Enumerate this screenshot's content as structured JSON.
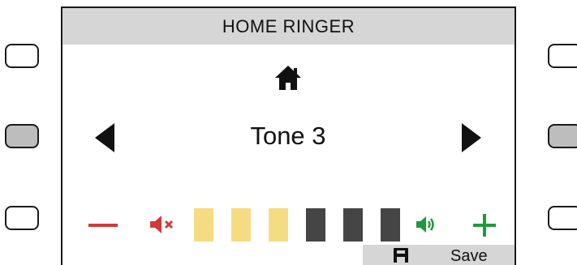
{
  "screen": {
    "title": "HOME RINGER",
    "header_icon": "home-icon",
    "tone": "Tone 3",
    "prev_icon": "left-triangle-icon",
    "next_icon": "right-triangle-icon"
  },
  "volume": {
    "level": 3,
    "max": 6,
    "decrease_icon": "minus-icon",
    "mute_icon": "speaker-mute-icon",
    "loud_icon": "speaker-loud-icon",
    "increase_icon": "plus-icon",
    "colors": {
      "on": "#f5dc82",
      "off": "#454545",
      "decrease": "#d23a3a",
      "increase": "#1f9a3a"
    }
  },
  "softkey": {
    "save_label": "Save",
    "save_icon": "floppy-disk-icon"
  },
  "side_keys": {
    "left": [
      {
        "name": "left-softkey-1",
        "active": false
      },
      {
        "name": "left-softkey-2",
        "active": true
      },
      {
        "name": "left-softkey-3",
        "active": false
      }
    ],
    "right": [
      {
        "name": "right-softkey-1",
        "active": false
      },
      {
        "name": "right-softkey-2",
        "active": true
      },
      {
        "name": "right-softkey-3",
        "active": false
      }
    ]
  }
}
